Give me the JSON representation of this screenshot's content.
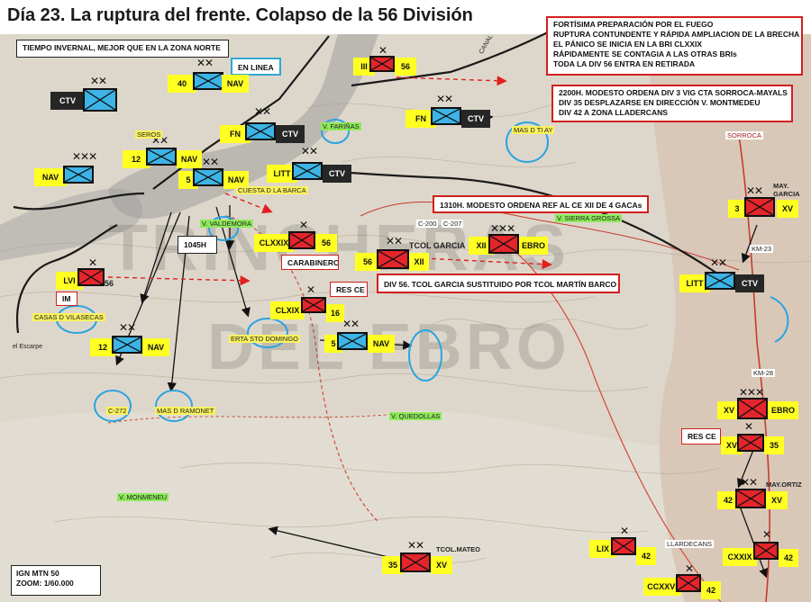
{
  "title": "Día 23. La ruptura del frente. Colapso de la 56 División",
  "notes": {
    "weather": "TIEMPO INVERNAL, MEJOR QUE EN LA ZONA NORTE",
    "front_box": [
      "FORTÍSIMA PREPARACIÓN POR EL FUEGO",
      "RUPTURA CONTUNDENTE Y RÁPIDA AMPLIACION DE LA BRECHA",
      "EL PÁNICO SE INICIA EN LA BRI  CLXXIX",
      "RÁPIDAMENTE SE CONTAGIA A LAS OTRAS BRIs",
      "TODA LA DIV 56 ENTRA EN RETIRADA"
    ],
    "order_2200": [
      "2200H. MODESTO ORDENA  DIV 3 VIG CTA SORROCA-MAYALS",
      "DIV 35 DESPLAZARSE EN DIRECCIÓN V. MONTMEDEU",
      "DIV 42 A  ZONA LLADERCANS"
    ],
    "order_1310": "1310H. MODESTO ORDENA REF AL CE XII DE 4 GACAs",
    "div56_note": "DIV 56. TCOL GARCIA SUSTITUIDO POR TCOL MARTÍN BARCO",
    "en_linea": "EN LINEA",
    "time_1045": "1045H",
    "carabineros": "CARABINEROS",
    "res_ce_1": "RES CE",
    "res_ce_2": "RES CE",
    "im": "IM",
    "map_ref": [
      "IGN MTN 50",
      "ZOOM: 1/60.000"
    ]
  },
  "units": [
    {
      "id": "nav40",
      "side": "blue",
      "num": "40",
      "corps": "NAV",
      "echelon": "XX"
    },
    {
      "id": "ctv1",
      "side": "blue",
      "num": "",
      "corps": "CTV",
      "echelon": "XX"
    },
    {
      "id": "fn1",
      "side": "blue",
      "num": "FN",
      "corps": "CTV",
      "echelon": "XX"
    },
    {
      "id": "nav12a",
      "side": "blue",
      "num": "12",
      "corps": "NAV",
      "echelon": "XX"
    },
    {
      "id": "navcorps",
      "side": "blue",
      "num": "NAV",
      "corps": "",
      "echelon": "XXX"
    },
    {
      "id": "nav5a",
      "side": "blue",
      "num": "5",
      "corps": "NAV",
      "echelon": "XX"
    },
    {
      "id": "littctv",
      "side": "blue",
      "num": "LITT",
      "corps": "CTV",
      "echelon": "XX"
    },
    {
      "id": "fn2",
      "side": "blue",
      "num": "FN",
      "corps": "CTV",
      "echelon": "XX"
    },
    {
      "id": "litt2",
      "side": "blue",
      "num": "LITT",
      "corps": "CTV",
      "echelon": "XX"
    },
    {
      "id": "nav12b",
      "side": "blue",
      "num": "12",
      "corps": "NAV",
      "echelon": "XX"
    },
    {
      "id": "nav5b",
      "side": "blue",
      "num": "5",
      "corps": "NAV",
      "echelon": "XX"
    },
    {
      "id": "r3",
      "side": "red",
      "num": "III",
      "corps": "56",
      "echelon": "X"
    },
    {
      "id": "rclxxix",
      "side": "red",
      "num": "CLXXIX",
      "corps": "56",
      "echelon": "X"
    },
    {
      "id": "rxii",
      "side": "red",
      "num": "56",
      "corps": "XII",
      "echelon": "XX"
    },
    {
      "id": "rxiiebro",
      "side": "red",
      "num": "XII",
      "corps": "EBRO",
      "echelon": "XXX"
    },
    {
      "id": "rlvi",
      "side": "red",
      "num": "LVI",
      "corps": "56",
      "echelon": "X"
    },
    {
      "id": "rclxix",
      "side": "red",
      "num": "CLXIX",
      "corps": "16",
      "echelon": "X"
    },
    {
      "id": "r3xv",
      "side": "red",
      "num": "3",
      "corps": "XV",
      "echelon": "XX"
    },
    {
      "id": "rxvebro",
      "side": "red",
      "num": "XV",
      "corps": "EBRO",
      "echelon": "XXX"
    },
    {
      "id": "rxv35",
      "side": "red",
      "num": "XV",
      "corps": "35",
      "echelon": "X"
    },
    {
      "id": "r42xv",
      "side": "red",
      "num": "42",
      "corps": "XV",
      "echelon": "XX"
    },
    {
      "id": "rlix",
      "side": "red",
      "num": "LIX",
      "corps": "42",
      "echelon": "X"
    },
    {
      "id": "rcxxix",
      "side": "red",
      "num": "CXXIX",
      "corps": "42",
      "echelon": "X"
    },
    {
      "id": "rccxxvi",
      "side": "red",
      "num": "CCXXVI",
      "corps": "42",
      "echelon": "X"
    },
    {
      "id": "r35xv",
      "side": "red",
      "num": "35",
      "corps": "XV",
      "echelon": "XX"
    }
  ],
  "commanders": {
    "may_garcia": [
      "MAY.",
      "GARCIA"
    ],
    "tcol_garcia": "TCOL GARCIA",
    "may_ortiz": "MAY.ORTIZ",
    "tcol_mateo": "TCOL.MATEO"
  },
  "places": {
    "seros": "SEROS",
    "cuesta": "CUESTA D LA BARCA",
    "valdemora": "V. VALDEMORA",
    "farinas": "V. FARIÑAS",
    "mas_tiay": "MAS D TI AY",
    "sorroca": "SORROCA",
    "sierra_grossa": "V. SIERRA GROSSA",
    "c200": "C-200",
    "c207": "C-207",
    "casas_vilasecas": "CASAS D VILASECAS",
    "erta_sto_domingo": "ERTA STO DOMINGO",
    "c272": "C-272",
    "mas_ramonet": "MAS D RAMONET",
    "quedollas": "V. QUEDOLLAS",
    "monmeneu": "V. MONMENEU",
    "llardecans": "LLARDECANS",
    "km23": "KM-23",
    "km28": "KM-28",
    "canal": "CANAL",
    "el_escarp": "el Escarpe"
  },
  "watermark": [
    "TRINCHERAS",
    "DEL EBRO"
  ],
  "colors": {
    "nationalist": "#3cb4e6",
    "republican": "#e4252b",
    "label": "#ffff22",
    "arrow_red": "#e21f1f",
    "circle": "#2aa4e0"
  }
}
